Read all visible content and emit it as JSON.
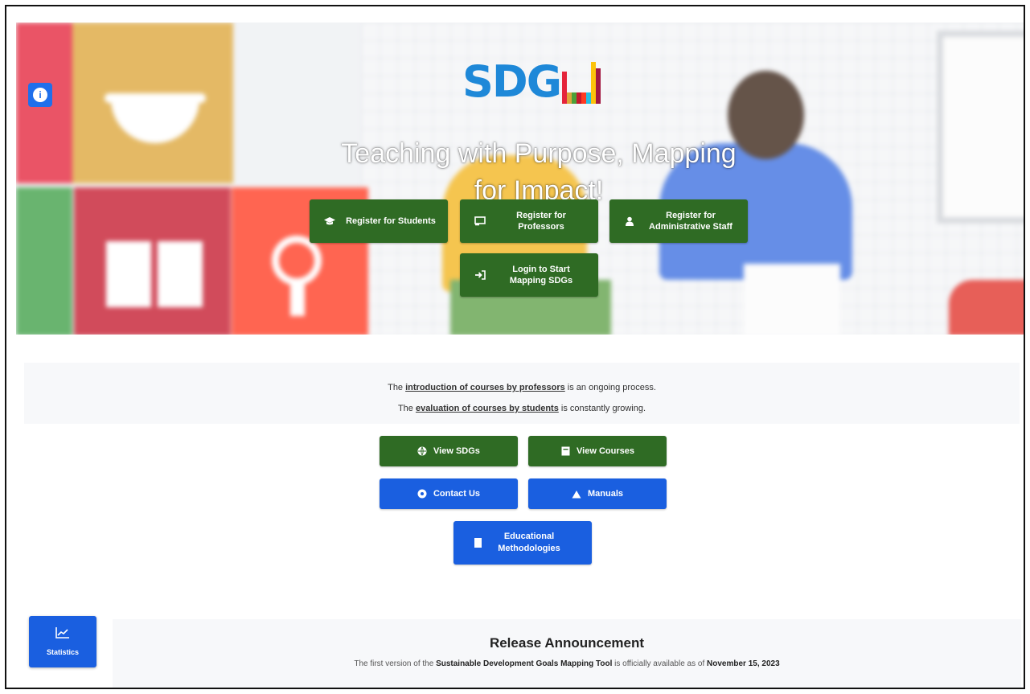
{
  "hero": {
    "logo_text": "SDG",
    "logo_suffix": "U",
    "tagline": "Teaching with Purpose, Mapping for Impact!",
    "buttons": {
      "register_students": "Register for Students",
      "register_professors": "Register for Professors",
      "register_staff": "Register for Administrative Staff",
      "login": "Login to Start Mapping SDGs"
    }
  },
  "status": {
    "line1_prefix": "The ",
    "line1_link": "introduction of courses by professors",
    "line1_suffix": " is an ongoing process.",
    "line2_prefix": "The ",
    "line2_link": "evaluation of courses by students",
    "line2_suffix": " is constantly growing."
  },
  "actions": {
    "view_sdgs": "View SDGs",
    "view_courses": "View Courses",
    "contact_us": "Contact Us",
    "manuals": "Manuals",
    "methodologies": "Educational Methodologies"
  },
  "stats_button": "Statistics",
  "release": {
    "title": "Release Announcement",
    "text_prefix": "The first version of the ",
    "text_tool": "Sustainable Development Goals Mapping Tool",
    "text_middle": " is officially available as of ",
    "text_date": "November 15, 2023"
  },
  "colors": {
    "primary_green": "#2f6b24",
    "primary_blue": "#1a5fe0",
    "logo_blue": "#1e88d8"
  },
  "icons": [
    "info-icon",
    "graduation-cap-icon",
    "chalkboard-icon",
    "user-icon",
    "login-icon",
    "globe-icon",
    "book-icon",
    "question-circle-icon",
    "manual-icon",
    "bookmark-icon",
    "chart-icon"
  ]
}
